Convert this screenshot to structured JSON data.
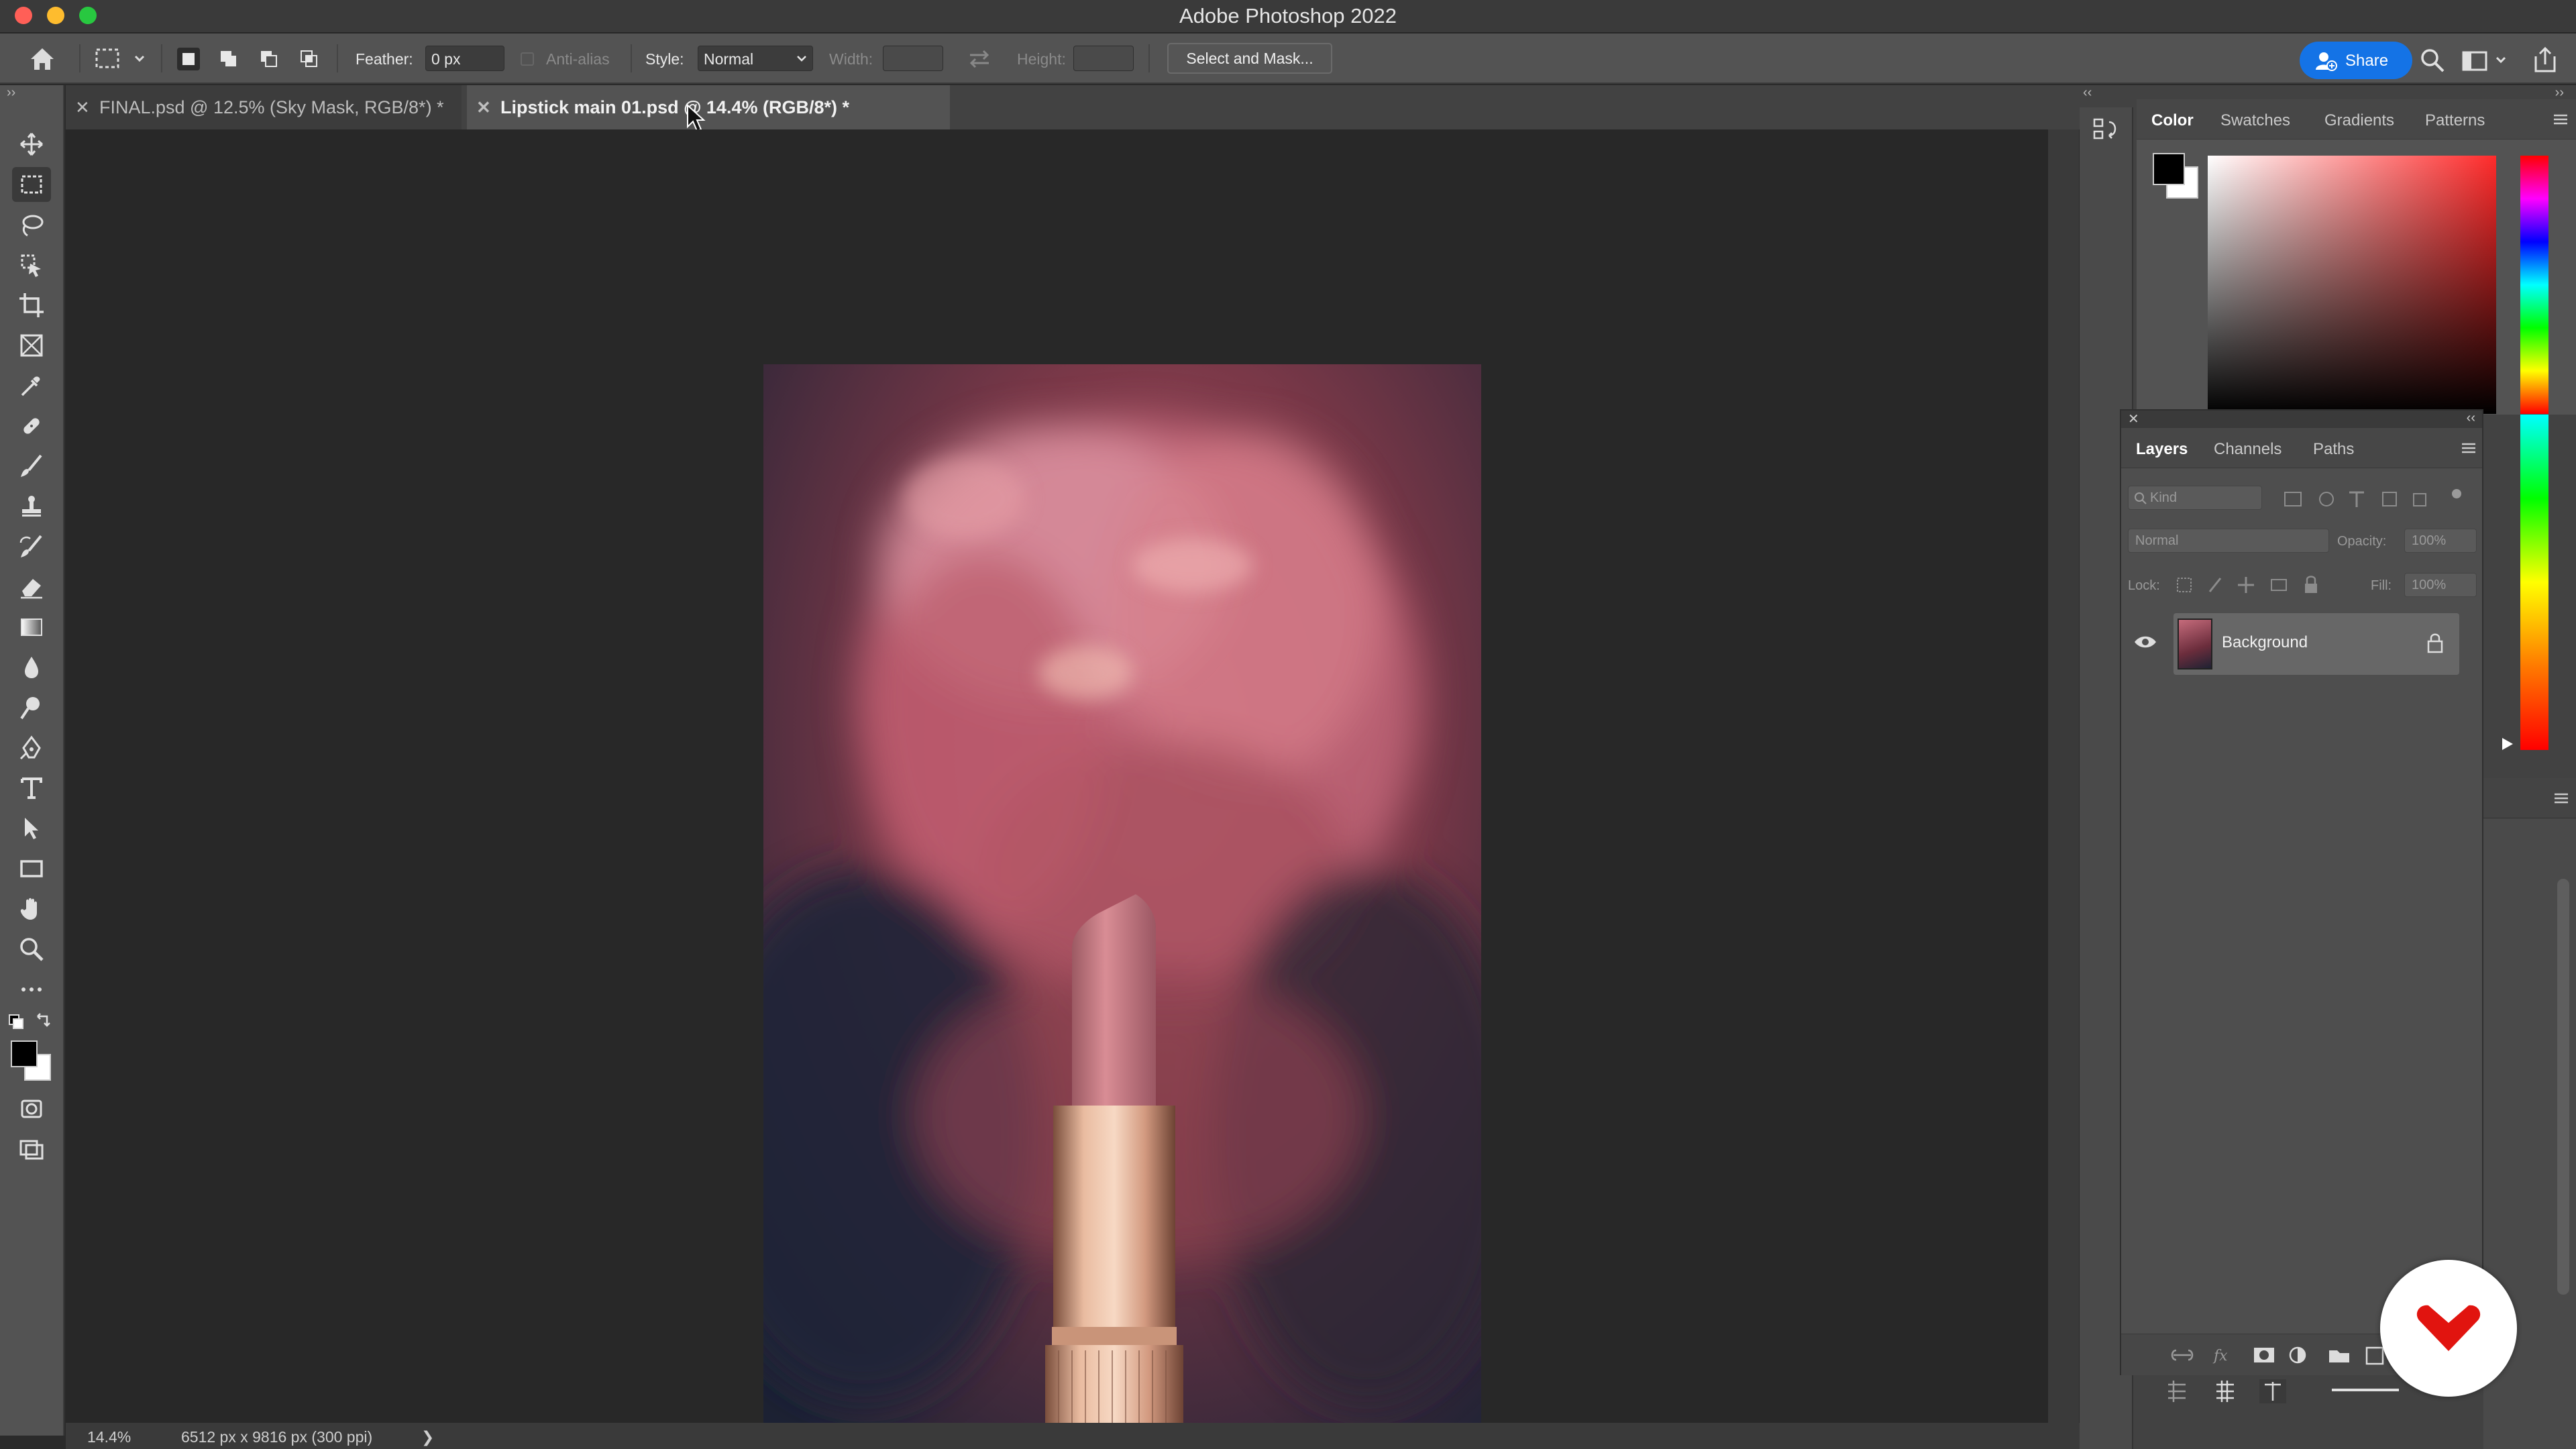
{
  "app": {
    "title": "Adobe Photoshop 2022"
  },
  "options_bar": {
    "feather_label": "Feather:",
    "feather_value": "0 px",
    "anti_alias_label": "Anti-alias",
    "style_label": "Style:",
    "style_value": "Normal",
    "width_label": "Width:",
    "height_label": "Height:",
    "select_mask_label": "Select and Mask...",
    "share_label": "Share"
  },
  "tabs": [
    {
      "label": "FINAL.psd @ 12.5% (Sky Mask, RGB/8*) *",
      "active": false
    },
    {
      "label": "Lipstick main 01.psd @ 14.4% (RGB/8*) *",
      "active": true
    }
  ],
  "status": {
    "zoom": "14.4%",
    "doc_info": "6512 px x 9816 px (300 ppi)",
    "arrow": "❯"
  },
  "color_panel": {
    "tabs": [
      "Color",
      "Swatches",
      "Gradients",
      "Patterns"
    ],
    "foreground": "#000000",
    "background": "#ffffff",
    "hue": "#ff3b3b"
  },
  "layers_panel": {
    "tabs": [
      "Layers",
      "Channels",
      "Paths"
    ],
    "filter_placeholder": "Kind",
    "blend_mode": "Normal",
    "opacity_label": "Opacity:",
    "opacity_value": "100%",
    "lock_label": "Lock:",
    "fill_label": "Fill:",
    "fill_value": "100%",
    "layers": [
      {
        "name": "Background",
        "visible": true,
        "locked": true
      }
    ]
  },
  "colors": {
    "accent_blue": "#1473e6",
    "panel": "#535353",
    "canvas": "#282828"
  }
}
